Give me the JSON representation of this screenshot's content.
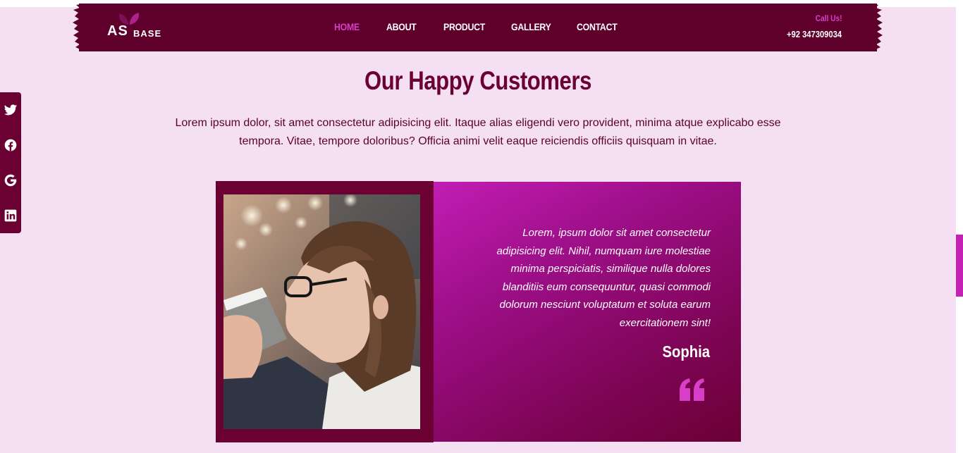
{
  "brand": {
    "logo_main": "AS",
    "logo_sub": "BASE"
  },
  "nav": {
    "items": [
      {
        "label": "HOME",
        "active": true
      },
      {
        "label": "ABOUT",
        "active": false
      },
      {
        "label": "PRODUCT",
        "active": false
      },
      {
        "label": "GALLERY",
        "active": false
      },
      {
        "label": "CONTACT",
        "active": false
      }
    ]
  },
  "contact": {
    "call_label": "Call Us!",
    "phone": "+92 347309034"
  },
  "social": {
    "icons": [
      "twitter-icon",
      "facebook-icon",
      "google-icon",
      "linkedin-icon"
    ]
  },
  "section": {
    "title": "Our Happy Customers",
    "description": "Lorem ipsum dolor, sit amet consectetur adipisicing elit. Itaque alias eligendi vero provident, minima atque explicabo esse tempora. Vitae, tempore doloribus? Officia animi velit eaque reiciendis officiis quisquam in vitae."
  },
  "testimonial": {
    "quote": "Lorem, ipsum dolor sit amet consectetur adipisicing elit. Nihil, numquam iure molestiae minima perspiciatis, similique nulla dolores blanditiis eum consequuntur, quasi commodi dolorum nesciunt voluptatum et soluta earum exercitationem sint!",
    "author": "Sophia"
  },
  "colors": {
    "page_bg": "#f5dff3",
    "header_bg": "#5e002b",
    "accent": "#d83fc8",
    "title": "#6b0032"
  }
}
